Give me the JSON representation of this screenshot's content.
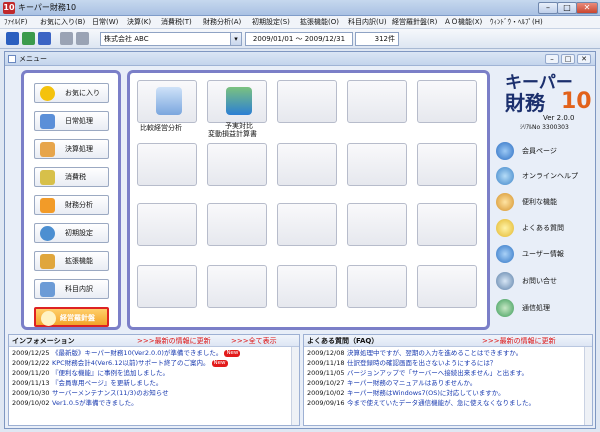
{
  "window": {
    "title": "キーパー財務10",
    "icon_text": "10"
  },
  "menubar": {
    "items": [
      "ﾌｧｲﾙ(F)",
      "お気に入り(B)",
      "日常(W)",
      "決算(K)",
      "消費税(T)",
      "財務分析(A)",
      "初期設定(S)",
      "拡張機能(O)",
      "科目内訳(U)",
      "経営羅針盤(R)",
      "ＡＯ機能(X)",
      "ｳｨﾝﾄﾞｳ・ﾍﾙﾌﾟ(H)"
    ]
  },
  "toolbar": {
    "company": "株式会社 ABC",
    "period": "2009/01/01 ～ 2009/12/31",
    "count": "312件"
  },
  "inner": {
    "title": "メニュー"
  },
  "nav": {
    "items": [
      "お気に入り",
      "日常処理",
      "決算処理",
      "消費税",
      "財務分析",
      "初期設定",
      "拡張機能",
      "科目内訳",
      "経営羅針盤"
    ]
  },
  "tiles": {
    "t1": "比較経営分析",
    "t2_line1": "予実対比",
    "t2_line2": "変動損益計算書"
  },
  "brand": {
    "line1": "キーパー",
    "line2": "財務",
    "num": "10",
    "version": "Ver 2.0.0",
    "serial": "ｼﾘｱﾙNo 3300303"
  },
  "links": [
    "会員ページ",
    "オンラインヘルプ",
    "便利な機能",
    "よくある質問",
    "ユーザー情報",
    "お問い合せ",
    "通信処理"
  ],
  "info": {
    "title": "インフォメーション",
    "latest": ">>>最新の情報に更新",
    "showall": ">>>全て表示",
    "new_badge": "New",
    "rows": [
      {
        "date": "2009/12/25",
        "text": "《最新版》キーパー財務10(Ver2.0.0)が準備できました。",
        "new": true
      },
      {
        "date": "2009/12/22",
        "text": "KPC財務会計4(Ver6.12以前)サポート終了のご案内。",
        "new": true
      },
      {
        "date": "2009/11/20",
        "text": "『便利な機能』に事例を追加しました。",
        "new": false
      },
      {
        "date": "2009/11/13",
        "text": "『会員専用ページ』を更新しました。",
        "new": false
      },
      {
        "date": "2009/10/30",
        "text": "サーバーメンテナンス(11/3)のお知らせ",
        "new": false
      },
      {
        "date": "2009/10/02",
        "text": "Ver1.0.5が準備できました。",
        "new": false
      }
    ]
  },
  "faq": {
    "title": "よくある質問（FAQ）",
    "latest": ">>>最新の情報に更新",
    "rows": [
      {
        "date": "2009/12/08",
        "text": "決算処理中ですが、翌期の入力を進めることはできますか。"
      },
      {
        "date": "2009/11/18",
        "text": "仕訳登録時の確認画面を出さないようにするには？"
      },
      {
        "date": "2009/11/05",
        "text": "バージョンアップで「サーバーへ接続出来ません」と出ます。"
      },
      {
        "date": "2009/10/27",
        "text": "キーパー財務のマニュアルはありませんか。"
      },
      {
        "date": "2009/10/02",
        "text": "キーパー財務はWindows7(OS)に対応していますか。"
      },
      {
        "date": "2009/09/16",
        "text": "今まで使えていたデータ通信機能が、急に使えなくなりました。"
      }
    ]
  },
  "colors": {
    "accent": "#7b7fc8",
    "brand": "#1b2f6d",
    "brand_num": "#e2621b",
    "new_badge": "#e21b1b",
    "info_link": "#1a3bb0"
  }
}
